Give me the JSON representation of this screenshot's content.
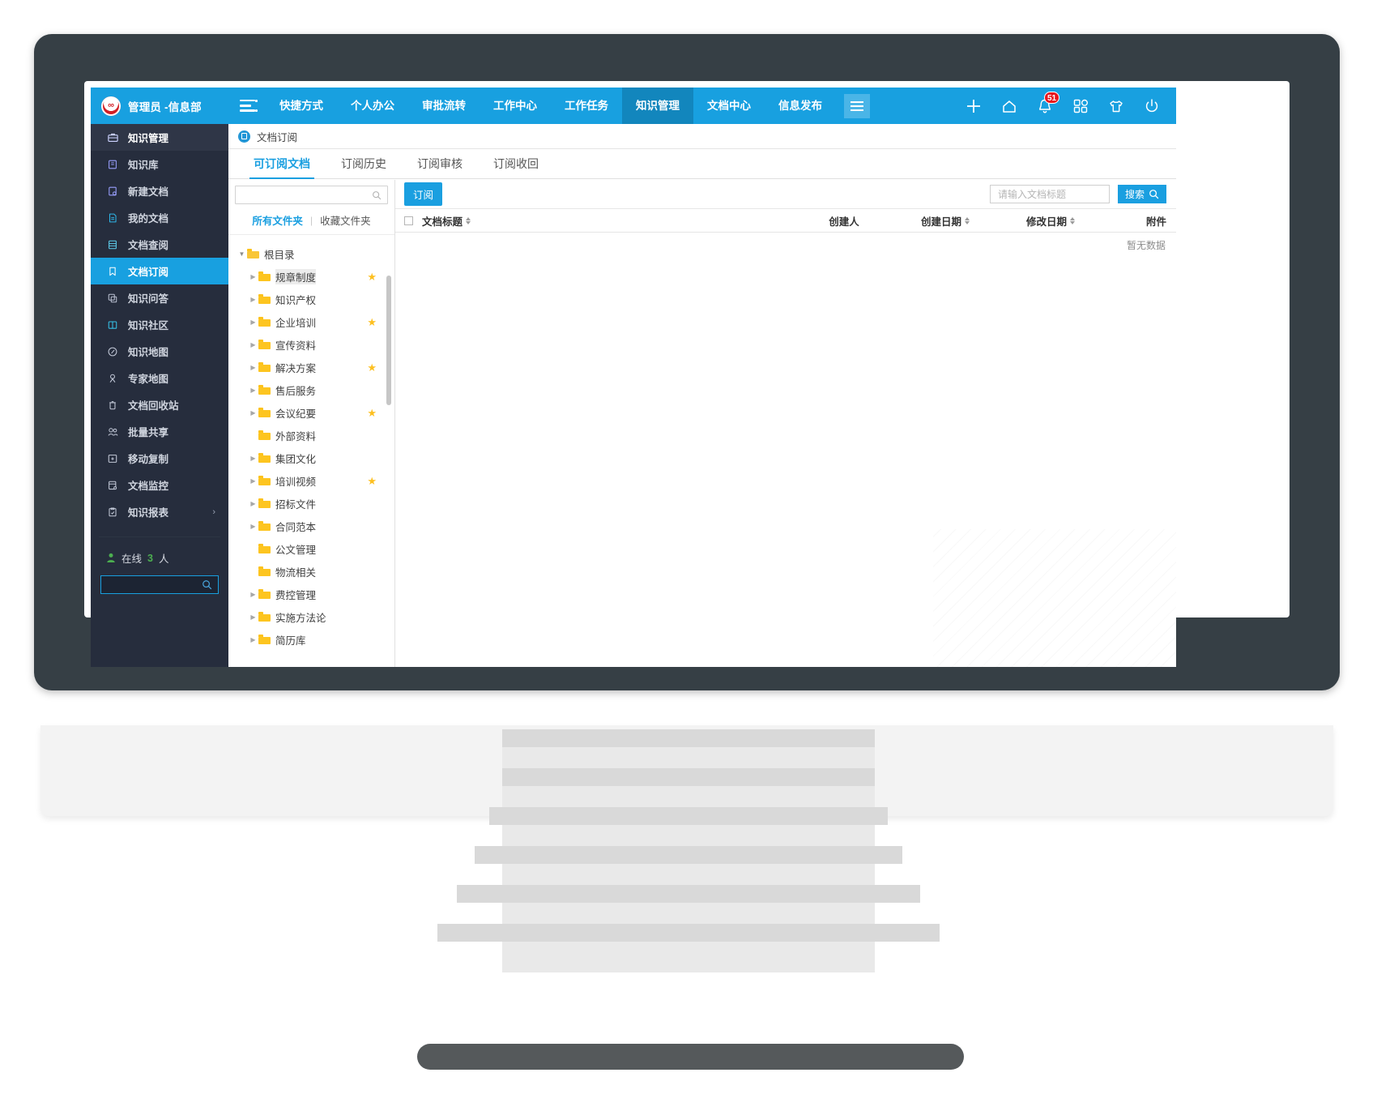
{
  "topbar": {
    "brand_name": "管理员 -信息部",
    "logo_text": "∞",
    "menu_toggle_icon": "list-collapse-icon",
    "grid_menu_icon": "hamburger-icon",
    "nav_items": [
      {
        "label": "快捷方式",
        "active": false
      },
      {
        "label": "个人办公",
        "active": false
      },
      {
        "label": "审批流转",
        "active": false
      },
      {
        "label": "工作中心",
        "active": false
      },
      {
        "label": "工作任务",
        "active": false
      },
      {
        "label": "知识管理",
        "active": true
      },
      {
        "label": "文档中心",
        "active": false
      },
      {
        "label": "信息发布",
        "active": false
      }
    ],
    "icons": [
      {
        "name": "plus-icon"
      },
      {
        "name": "home-icon"
      },
      {
        "name": "bell-icon",
        "badge": "51"
      },
      {
        "name": "apps-grid-icon"
      },
      {
        "name": "shirt-theme-icon"
      },
      {
        "name": "power-icon"
      }
    ]
  },
  "sidebar": {
    "header": {
      "label": "知识管理",
      "icon": "briefcase-icon"
    },
    "items": [
      {
        "label": "知识库",
        "icon": "book-icon",
        "active": false
      },
      {
        "label": "新建文档",
        "icon": "new-doc-icon",
        "active": false
      },
      {
        "label": "我的文档",
        "icon": "my-doc-icon",
        "active": false
      },
      {
        "label": "文档查阅",
        "icon": "doc-view-icon",
        "active": false
      },
      {
        "label": "文档订阅",
        "icon": "bookmark-icon",
        "active": true
      },
      {
        "label": "知识问答",
        "icon": "qa-icon",
        "active": false
      },
      {
        "label": "知识社区",
        "icon": "community-icon",
        "active": false
      },
      {
        "label": "知识地图",
        "icon": "compass-icon",
        "active": false
      },
      {
        "label": "专家地图",
        "icon": "expert-icon",
        "active": false
      },
      {
        "label": "文档回收站",
        "icon": "trash-icon",
        "active": false
      },
      {
        "label": "批量共享",
        "icon": "users-icon",
        "active": false
      },
      {
        "label": "移动复制",
        "icon": "move-copy-icon",
        "active": false
      },
      {
        "label": "文档监控",
        "icon": "monitor-icon",
        "active": false
      },
      {
        "label": "知识报表",
        "icon": "report-icon",
        "active": false,
        "chevron": "›"
      }
    ],
    "online": {
      "label": "在线",
      "count": "3",
      "unit": "人",
      "icon": "person-icon"
    },
    "search_icon": "search-icon"
  },
  "breadcrumb": {
    "icon": "doc-circle-icon",
    "text": "文档订阅"
  },
  "page_tabs": [
    {
      "label": "可订阅文档",
      "active": true
    },
    {
      "label": "订阅历史",
      "active": false
    },
    {
      "label": "订阅审核",
      "active": false
    },
    {
      "label": "订阅收回",
      "active": false
    }
  ],
  "folder_panel": {
    "search_icon": "search-icon",
    "tabs": [
      {
        "label": "所有文件夹",
        "active": true
      },
      {
        "label": "收藏文件夹",
        "active": false
      }
    ],
    "separator": "|",
    "tree": [
      {
        "label": "根目录",
        "depth": 0,
        "caret": "down",
        "star": false,
        "selected": false
      },
      {
        "label": "规章制度",
        "depth": 1,
        "caret": "right",
        "star": true,
        "selected": true
      },
      {
        "label": "知识产权",
        "depth": 1,
        "caret": "right",
        "star": false,
        "selected": false
      },
      {
        "label": "企业培训",
        "depth": 1,
        "caret": "right",
        "star": true,
        "selected": false
      },
      {
        "label": "宣传资料",
        "depth": 1,
        "caret": "right",
        "star": false,
        "selected": false
      },
      {
        "label": "解决方案",
        "depth": 1,
        "caret": "right",
        "star": true,
        "selected": false
      },
      {
        "label": "售后服务",
        "depth": 1,
        "caret": "right",
        "star": false,
        "selected": false
      },
      {
        "label": "会议纪要",
        "depth": 1,
        "caret": "right",
        "star": true,
        "selected": false
      },
      {
        "label": "外部资料",
        "depth": 1,
        "caret": "none",
        "star": false,
        "selected": false
      },
      {
        "label": "集团文化",
        "depth": 1,
        "caret": "right",
        "star": false,
        "selected": false
      },
      {
        "label": "培训视频",
        "depth": 1,
        "caret": "right",
        "star": true,
        "selected": false
      },
      {
        "label": "招标文件",
        "depth": 1,
        "caret": "right",
        "star": false,
        "selected": false
      },
      {
        "label": "合同范本",
        "depth": 1,
        "caret": "right",
        "star": false,
        "selected": false
      },
      {
        "label": "公文管理",
        "depth": 1,
        "caret": "none",
        "star": false,
        "selected": false
      },
      {
        "label": "物流相关",
        "depth": 1,
        "caret": "none",
        "star": false,
        "selected": false
      },
      {
        "label": "费控管理",
        "depth": 1,
        "caret": "right",
        "star": false,
        "selected": false
      },
      {
        "label": "实施方法论",
        "depth": 1,
        "caret": "right",
        "star": false,
        "selected": false
      },
      {
        "label": "简历库",
        "depth": 1,
        "caret": "right",
        "star": false,
        "selected": false
      }
    ]
  },
  "content": {
    "subscribe_button": "订阅",
    "search_placeholder": "请输入文档标题",
    "search_value": "",
    "search_button": "搜索",
    "search_icon": "search-icon",
    "columns": [
      {
        "label": "文档标题",
        "sortable": true
      },
      {
        "label": "创建人",
        "sortable": false
      },
      {
        "label": "创建日期",
        "sortable": true
      },
      {
        "label": "修改日期",
        "sortable": true
      },
      {
        "label": "附件",
        "sortable": false
      }
    ],
    "empty_text": "暂无数据",
    "rows": []
  },
  "colors": {
    "accent": "#18a0e0",
    "sidebar_bg": "#262d3d",
    "badge_red": "#e8151d",
    "folder_yellow": "#fdc520",
    "star_yellow": "#fdc021",
    "online_green": "#4caf50"
  }
}
